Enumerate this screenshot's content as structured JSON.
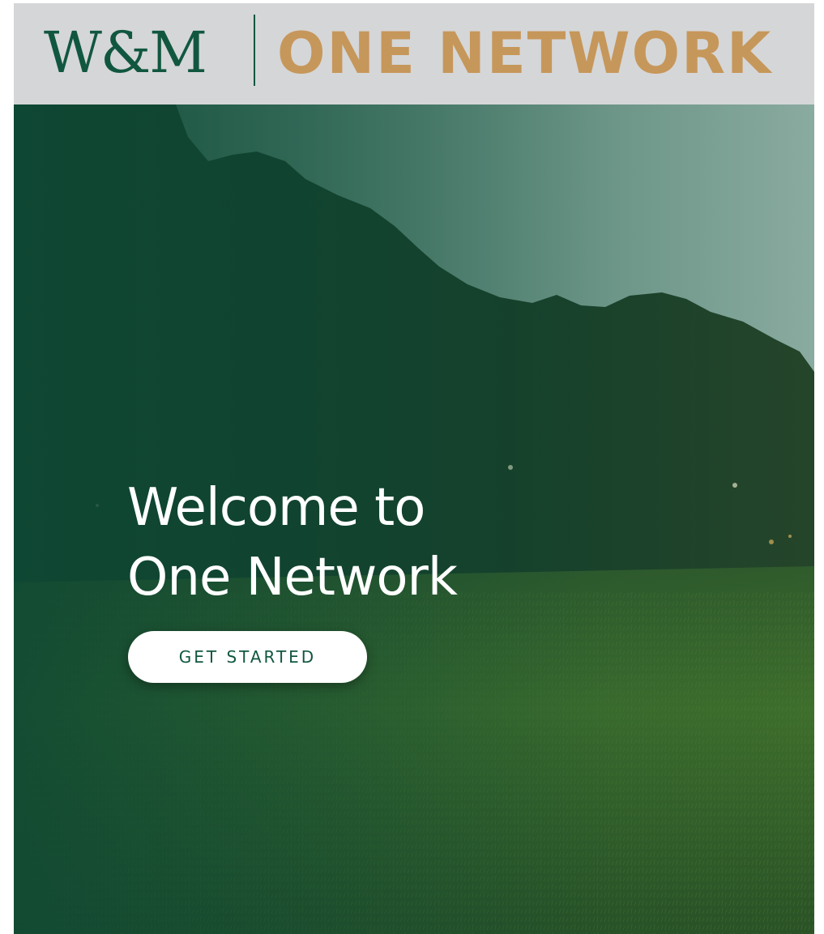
{
  "header": {
    "logo_wm": "W&M",
    "logo_product": "ONE NETWORK"
  },
  "hero": {
    "headline_line1": "Welcome to",
    "headline_line2": "One Network",
    "cta_label": "GET STARTED"
  },
  "colors": {
    "brand_green": "#115740",
    "brand_gold": "#c6975a",
    "header_bg": "#d5d6d8",
    "cta_bg": "#ffffff"
  }
}
